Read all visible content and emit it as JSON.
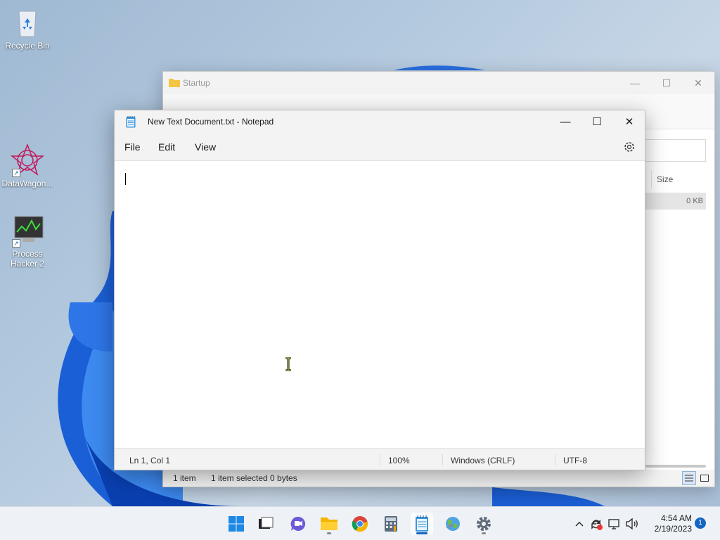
{
  "desktop": {
    "icons": [
      {
        "label": "Recycle Bin"
      },
      {
        "label": "DataWagon..."
      },
      {
        "label": "Process Hacker 2"
      }
    ]
  },
  "explorer": {
    "title": "Startup",
    "column_size": "Size",
    "row_size": "0 KB",
    "status_items": "1 item",
    "status_selected": "1 item selected  0 bytes"
  },
  "notepad": {
    "title": "New Text Document.txt - Notepad",
    "menu": [
      "File",
      "Edit",
      "View"
    ],
    "content": "",
    "status": {
      "position": "Ln 1, Col 1",
      "zoom": "100%",
      "line_ending": "Windows (CRLF)",
      "encoding": "UTF-8"
    }
  },
  "taskbar": {
    "apps": [
      "start-icon",
      "terminal-icon",
      "chat-icon",
      "file-explorer-icon",
      "chrome-icon",
      "calculator-icon",
      "notepad-icon",
      "earth-icon",
      "settings-icon"
    ],
    "clock_time": "4:54 AM",
    "clock_date": "2/19/2023",
    "notification_count": "1"
  },
  "colors": {
    "accent": "#1565c0",
    "wallpaper": "#b3c9de"
  }
}
